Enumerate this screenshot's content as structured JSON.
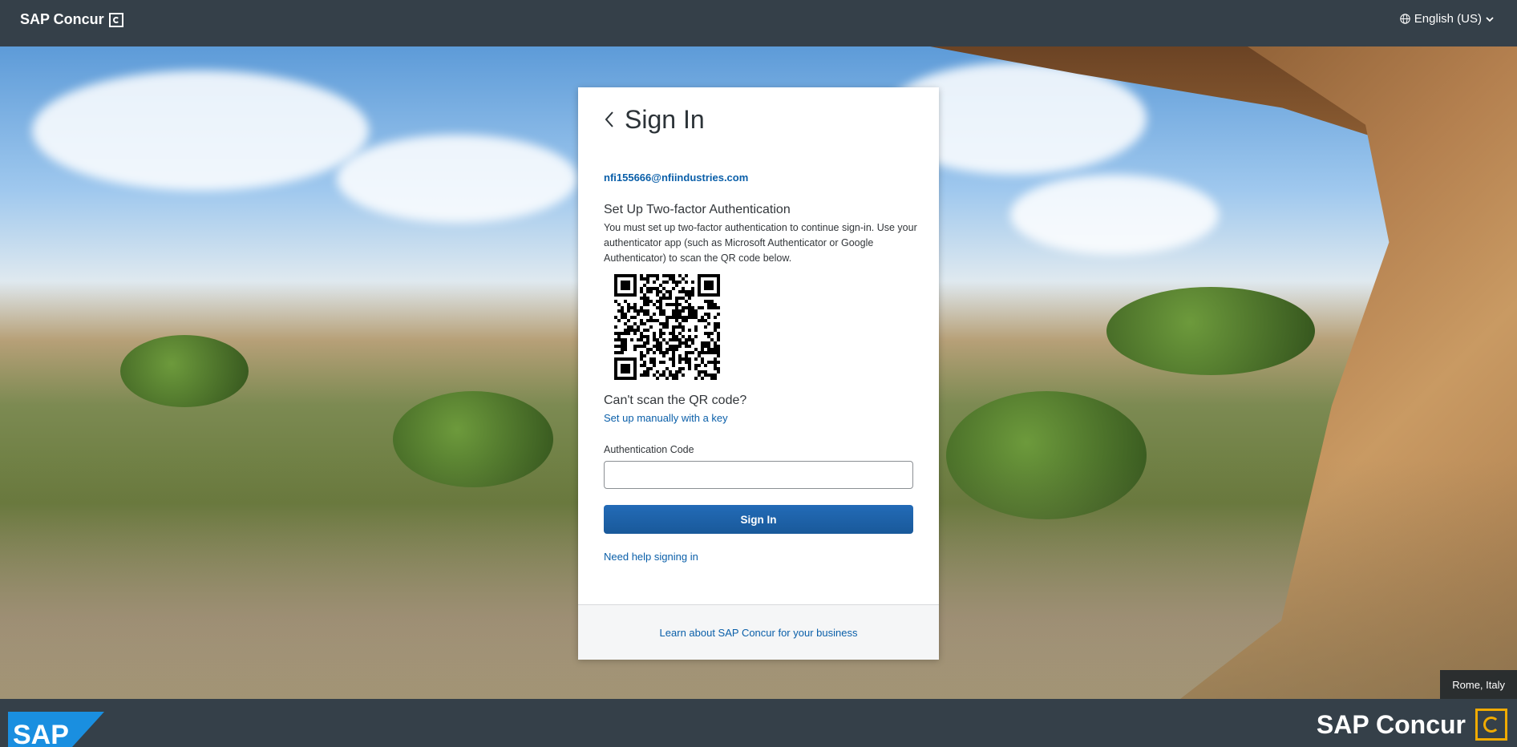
{
  "header": {
    "brand": "SAP Concur",
    "language": "English (US)"
  },
  "card": {
    "title": "Sign In",
    "email": "nfi155666@nfiindustries.com",
    "setup_title": "Set Up Two-factor Authentication",
    "setup_text": "You must set up two-factor authentication to continue sign-in. Use your authenticator app (such as Microsoft Authenticator or Google Authenticator) to scan the QR code below.",
    "cant_scan": "Can't scan the QR code?",
    "manual_link": "Set up manually with a key",
    "auth_label": "Authentication Code",
    "auth_value": "",
    "signin_label": "Sign In",
    "help_link": "Need help signing in",
    "learn_link": "Learn about SAP Concur for your business"
  },
  "location": "Rome, Italy",
  "footer": {
    "sap_logo": "SAP",
    "brand": "SAP Concur"
  },
  "colors": {
    "header_bg": "#354049",
    "link": "#0a5fa9",
    "button": "#1a64ab",
    "concur_accent": "#f0ab00"
  }
}
